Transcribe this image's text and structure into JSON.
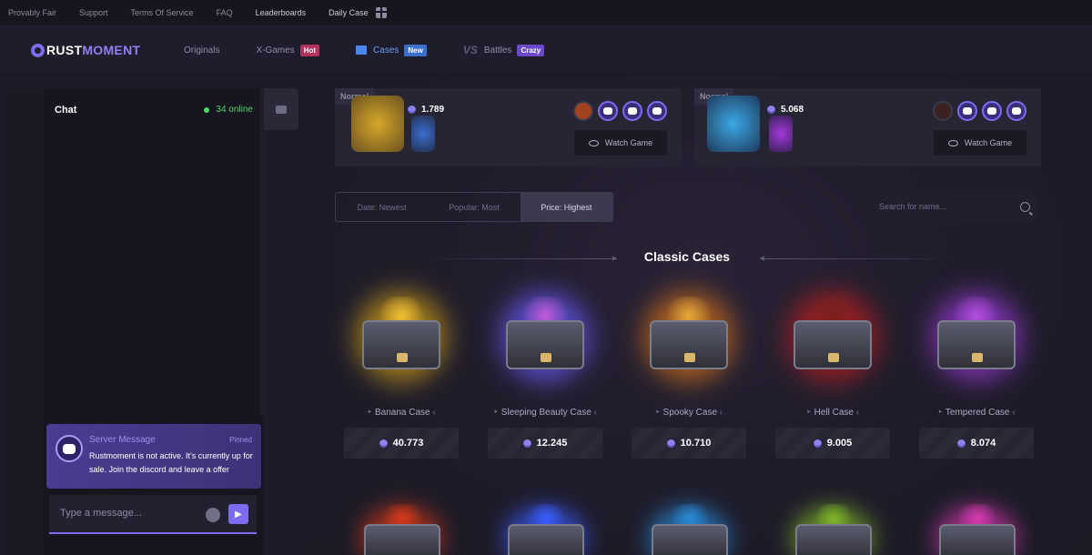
{
  "topbar": {
    "links": [
      "Provably Fair",
      "Support",
      "Terms Of Service",
      "FAQ",
      "Leaderboards",
      "Daily Case"
    ]
  },
  "nav": {
    "logo_a": "RUST",
    "logo_b": "MOMENT",
    "items": [
      {
        "label": "Originals",
        "badge": ""
      },
      {
        "label": "X-Games",
        "badge": "Hot"
      },
      {
        "label": "Cases",
        "badge": "New"
      },
      {
        "label": "Battles",
        "badge": "Crazy"
      }
    ],
    "vs": "VS"
  },
  "chat": {
    "title": "Chat",
    "online": "34 online",
    "server_title": "Server Message",
    "pinned": "Pinned",
    "server_text": "Rustmoment is not active. It's currently up for sale. Join the discord and leave a offer",
    "input_placeholder": "Type a message..."
  },
  "games": [
    {
      "label": "Normal",
      "price": "1.789",
      "watch": "Watch Game"
    },
    {
      "label": "Normal",
      "price": "5.068",
      "watch": "Watch Game"
    }
  ],
  "sort": [
    "Date: Newest",
    "Popular: Most",
    "Price: Highest"
  ],
  "search_placeholder": "Search for name...",
  "section_title": "Classic Cases",
  "cases": [
    {
      "name": "Banana Case",
      "price": "40.773",
      "color": "#d6a21a",
      "loot": "#f0c232"
    },
    {
      "name": "Sleeping Beauty Case",
      "price": "12.245",
      "color": "#6a5cff",
      "loot": "#c25bd8"
    },
    {
      "name": "Spooky Case",
      "price": "10.710",
      "color": "#d8741a",
      "loot": "#e7a93a"
    },
    {
      "name": "Hell Case",
      "price": "9.005",
      "color": "#c02020",
      "loot": "#7a1f1f"
    },
    {
      "name": "Tempered Case",
      "price": "8.074",
      "color": "#9b3bd8",
      "loot": "#b24fe0"
    }
  ],
  "cases_row2_colors": [
    "#d63a1a",
    "#3a5cff",
    "#2a8ad8",
    "#7fb52a",
    "#d63ab0"
  ]
}
